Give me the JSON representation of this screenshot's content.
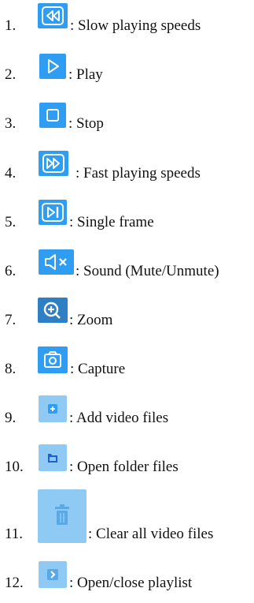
{
  "items": [
    {
      "number": "1.",
      "icon": "slow-speed-icon",
      "text": ": Slow playing speeds"
    },
    {
      "number": "2.",
      "icon": "play-icon",
      "text": ": Play"
    },
    {
      "number": "3.",
      "icon": "stop-icon",
      "text": ": Stop"
    },
    {
      "number": "4.",
      "icon": "fast-speed-icon",
      "text": ": Fast playing speeds"
    },
    {
      "number": "5.",
      "icon": "single-frame-icon",
      "text": ": Single frame"
    },
    {
      "number": "6.",
      "icon": "sound-mute-icon",
      "text": ": Sound (Mute/Unmute)"
    },
    {
      "number": "7.",
      "icon": "zoom-icon",
      "text": ": Zoom"
    },
    {
      "number": "8.",
      "icon": "capture-camera-icon",
      "text": ": Capture"
    },
    {
      "number": "9.",
      "icon": "add-file-icon",
      "text": ": Add video files"
    },
    {
      "number": "10.",
      "icon": "open-folder-icon",
      "text": ": Open folder files"
    },
    {
      "number": "11.",
      "icon": "trash-icon",
      "text": ": Clear all video files"
    },
    {
      "number": "12.",
      "icon": "playlist-toggle-icon",
      "text": ": Open/close playlist"
    }
  ],
  "colors": {
    "icon_blue": "#2e9df2",
    "icon_pale": "#8fcaf5",
    "icon_dark": "#2f7fc4",
    "glyph": "#ffffff"
  }
}
